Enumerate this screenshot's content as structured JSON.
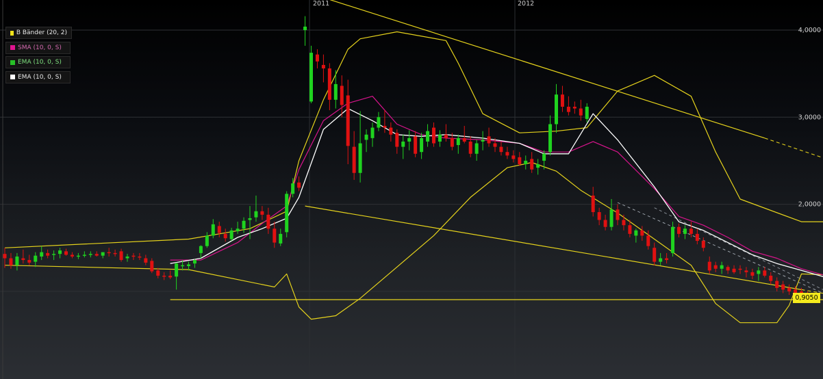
{
  "chart_data": {
    "type": "candlestick",
    "x_ticks": [
      "2011",
      "2012"
    ],
    "y_ticks": [
      "4,0000",
      "3,0000",
      "2,0000"
    ],
    "last_price_label": "0,9050",
    "legend": [
      {
        "label": "B Bänder (20, 2)",
        "color": "#f2e31b"
      },
      {
        "label": "SMA (10, 0, S)",
        "color": "#e0148f"
      },
      {
        "label": "EMA (10, 0, S)",
        "color": "#27c127"
      },
      {
        "label": "EMA (10, 0, S)",
        "color": "#ffffff"
      }
    ],
    "colors": {
      "up": "#1fd31f",
      "down": "#e01111",
      "band": "#e6d31c",
      "sma": "#d8148c",
      "ema": "#ffffff",
      "trend": "#e6d31c"
    },
    "candles": [
      [
        1.43,
        1.5,
        1.27,
        1.38
      ],
      [
        1.38,
        1.44,
        1.26,
        1.3
      ],
      [
        1.3,
        1.44,
        1.24,
        1.4
      ],
      [
        1.38,
        1.48,
        1.32,
        1.36
      ],
      [
        1.36,
        1.42,
        1.3,
        1.33
      ],
      [
        1.34,
        1.45,
        1.28,
        1.41
      ],
      [
        1.4,
        1.52,
        1.36,
        1.45
      ],
      [
        1.44,
        1.48,
        1.38,
        1.41
      ],
      [
        1.42,
        1.47,
        1.36,
        1.43
      ],
      [
        1.43,
        1.5,
        1.38,
        1.47
      ],
      [
        1.46,
        1.49,
        1.41,
        1.42
      ],
      [
        1.42,
        1.45,
        1.38,
        1.4
      ],
      [
        1.4,
        1.44,
        1.37,
        1.41
      ],
      [
        1.41,
        1.46,
        1.39,
        1.42
      ],
      [
        1.42,
        1.46,
        1.39,
        1.43
      ],
      [
        1.43,
        1.46,
        1.4,
        1.41
      ],
      [
        1.41,
        1.45,
        1.38,
        1.45
      ],
      [
        1.45,
        1.5,
        1.4,
        1.44
      ],
      [
        1.44,
        1.48,
        1.4,
        1.43
      ],
      [
        1.46,
        1.49,
        1.34,
        1.36
      ],
      [
        1.38,
        1.43,
        1.34,
        1.4
      ],
      [
        1.41,
        1.44,
        1.36,
        1.4
      ],
      [
        1.4,
        1.44,
        1.36,
        1.39
      ],
      [
        1.38,
        1.42,
        1.3,
        1.33
      ],
      [
        1.35,
        1.38,
        1.21,
        1.23
      ],
      [
        1.24,
        1.27,
        1.15,
        1.18
      ],
      [
        1.18,
        1.22,
        1.13,
        1.17
      ],
      [
        1.18,
        1.24,
        1.14,
        1.16
      ],
      [
        1.17,
        1.33,
        1.02,
        1.32
      ],
      [
        1.3,
        1.36,
        1.24,
        1.3
      ],
      [
        1.29,
        1.34,
        1.24,
        1.31
      ],
      [
        1.32,
        1.37,
        1.27,
        1.36
      ],
      [
        1.44,
        1.53,
        1.38,
        1.52
      ],
      [
        1.52,
        1.68,
        1.5,
        1.64
      ],
      [
        1.64,
        1.83,
        1.61,
        1.77
      ],
      [
        1.75,
        1.8,
        1.62,
        1.67
      ],
      [
        1.66,
        1.72,
        1.57,
        1.61
      ],
      [
        1.6,
        1.73,
        1.58,
        1.7
      ],
      [
        1.69,
        1.8,
        1.66,
        1.72
      ],
      [
        1.72,
        1.85,
        1.67,
        1.81
      ],
      [
        1.82,
        1.98,
        1.6,
        1.84
      ],
      [
        1.85,
        2.1,
        1.8,
        1.92
      ],
      [
        1.92,
        1.98,
        1.82,
        1.88
      ],
      [
        1.88,
        1.96,
        1.66,
        1.72
      ],
      [
        1.72,
        1.8,
        1.5,
        1.56
      ],
      [
        1.55,
        1.72,
        1.52,
        1.66
      ],
      [
        1.68,
        2.15,
        1.62,
        2.12
      ],
      [
        2.12,
        2.3,
        2.08,
        2.24
      ],
      [
        2.25,
        2.32,
        2.15,
        2.19
      ],
      [
        4.0,
        4.16,
        3.82,
        4.04
      ],
      [
        3.18,
        3.82,
        3.16,
        3.74
      ],
      [
        3.72,
        3.78,
        3.56,
        3.64
      ],
      [
        3.6,
        3.72,
        3.4,
        3.56
      ],
      [
        3.56,
        3.62,
        3.08,
        3.2
      ],
      [
        3.2,
        3.54,
        3.1,
        3.38
      ],
      [
        3.36,
        3.48,
        3.0,
        3.14
      ],
      [
        3.25,
        3.43,
        2.46,
        2.67
      ],
      [
        2.66,
        2.84,
        2.28,
        2.36
      ],
      [
        2.36,
        3.07,
        2.25,
        2.7
      ],
      [
        2.74,
        2.86,
        2.6,
        2.8
      ],
      [
        2.76,
        2.94,
        2.66,
        2.88
      ],
      [
        2.88,
        3.06,
        2.84,
        3.0
      ],
      [
        2.9,
        3.08,
        2.82,
        2.88
      ],
      [
        2.88,
        2.94,
        2.72,
        2.8
      ],
      [
        2.82,
        2.86,
        2.58,
        2.66
      ],
      [
        2.66,
        2.8,
        2.52,
        2.72
      ],
      [
        2.72,
        2.85,
        2.62,
        2.76
      ],
      [
        2.78,
        2.84,
        2.54,
        2.58
      ],
      [
        2.6,
        2.82,
        2.52,
        2.76
      ],
      [
        2.72,
        2.92,
        2.66,
        2.84
      ],
      [
        2.88,
        2.94,
        2.66,
        2.7
      ],
      [
        2.72,
        2.85,
        2.66,
        2.8
      ],
      [
        2.8,
        2.92,
        2.72,
        2.76
      ],
      [
        2.76,
        2.82,
        2.62,
        2.66
      ],
      [
        2.68,
        2.8,
        2.58,
        2.76
      ],
      [
        2.76,
        2.9,
        2.7,
        2.72
      ],
      [
        2.72,
        2.78,
        2.54,
        2.58
      ],
      [
        2.58,
        2.74,
        2.5,
        2.7
      ],
      [
        2.72,
        2.84,
        2.62,
        2.74
      ],
      [
        2.78,
        2.88,
        2.66,
        2.7
      ],
      [
        2.7,
        2.76,
        2.6,
        2.66
      ],
      [
        2.66,
        2.72,
        2.56,
        2.6
      ],
      [
        2.6,
        2.66,
        2.52,
        2.56
      ],
      [
        2.56,
        2.62,
        2.48,
        2.52
      ],
      [
        2.54,
        2.6,
        2.44,
        2.46
      ],
      [
        2.46,
        2.56,
        2.4,
        2.5
      ],
      [
        2.52,
        2.6,
        2.36,
        2.4
      ],
      [
        2.42,
        2.52,
        2.34,
        2.46
      ],
      [
        2.5,
        2.62,
        2.4,
        2.58
      ],
      [
        2.6,
        3.02,
        2.56,
        2.92
      ],
      [
        2.92,
        3.38,
        2.82,
        3.26
      ],
      [
        3.26,
        3.36,
        3.06,
        3.12
      ],
      [
        3.12,
        3.24,
        3.02,
        3.06
      ],
      [
        3.12,
        3.18,
        3.04,
        3.1
      ],
      [
        3.1,
        3.2,
        2.96,
        3.02
      ],
      [
        2.98,
        3.16,
        2.94,
        3.12
      ],
      [
        2.1,
        2.2,
        1.86,
        1.91
      ],
      [
        1.91,
        1.96,
        1.76,
        1.82
      ],
      [
        1.82,
        1.88,
        1.7,
        1.74
      ],
      [
        1.74,
        2.06,
        1.7,
        1.94
      ],
      [
        1.94,
        2.0,
        1.76,
        1.82
      ],
      [
        1.82,
        1.88,
        1.7,
        1.76
      ],
      [
        1.76,
        1.82,
        1.62,
        1.66
      ],
      [
        1.64,
        1.72,
        1.56,
        1.7
      ],
      [
        1.7,
        1.75,
        1.58,
        1.64
      ],
      [
        1.64,
        1.7,
        1.48,
        1.52
      ],
      [
        1.5,
        1.56,
        1.3,
        1.34
      ],
      [
        1.34,
        1.44,
        1.3,
        1.38
      ],
      [
        1.38,
        1.44,
        1.32,
        1.36
      ],
      [
        1.44,
        1.8,
        1.4,
        1.74
      ],
      [
        1.74,
        1.78,
        1.62,
        1.66
      ],
      [
        1.66,
        1.76,
        1.6,
        1.72
      ],
      [
        1.72,
        1.8,
        1.62,
        1.66
      ],
      [
        1.66,
        1.72,
        1.54,
        1.58
      ],
      [
        1.58,
        1.62,
        1.46,
        1.5
      ],
      [
        1.34,
        1.4,
        1.2,
        1.24
      ],
      [
        1.3,
        1.34,
        1.22,
        1.26
      ],
      [
        1.26,
        1.34,
        1.2,
        1.3
      ],
      [
        1.28,
        1.3,
        1.2,
        1.24
      ],
      [
        1.26,
        1.3,
        1.2,
        1.22
      ],
      [
        1.26,
        1.3,
        1.2,
        1.25
      ],
      [
        1.24,
        1.28,
        1.16,
        1.22
      ],
      [
        1.22,
        1.26,
        1.14,
        1.18
      ],
      [
        1.2,
        1.28,
        1.12,
        1.24
      ],
      [
        1.24,
        1.28,
        1.16,
        1.18
      ],
      [
        1.18,
        1.22,
        1.08,
        1.12
      ],
      [
        1.12,
        1.16,
        1.0,
        1.04
      ],
      [
        1.08,
        1.12,
        0.98,
        1.02
      ],
      [
        1.04,
        1.08,
        0.96,
        1.0
      ],
      [
        1.02,
        1.06,
        0.94,
        0.98
      ],
      [
        1.0,
        1.04,
        0.92,
        0.96
      ],
      [
        0.98,
        1.0,
        0.9,
        0.91
      ]
    ],
    "bollinger_upper": [
      [
        0,
        1.5
      ],
      [
        30,
        1.6
      ],
      [
        40,
        1.72
      ],
      [
        46,
        1.92
      ],
      [
        48,
        2.5
      ],
      [
        52,
        3.2
      ],
      [
        56,
        3.78
      ],
      [
        58,
        3.9
      ],
      [
        64,
        3.98
      ],
      [
        72,
        3.88
      ],
      [
        74,
        3.62
      ],
      [
        78,
        3.04
      ],
      [
        84,
        2.82
      ],
      [
        90,
        2.84
      ],
      [
        95,
        2.88
      ],
      [
        100,
        3.3
      ],
      [
        106,
        3.48
      ],
      [
        112,
        3.24
      ],
      [
        116,
        2.6
      ],
      [
        120,
        2.06
      ],
      [
        130,
        1.8
      ],
      [
        138,
        1.8
      ]
    ],
    "bollinger_lower": [
      [
        0,
        1.3
      ],
      [
        30,
        1.25
      ],
      [
        44,
        1.05
      ],
      [
        46,
        1.2
      ],
      [
        48,
        0.82
      ],
      [
        50,
        0.68
      ],
      [
        54,
        0.72
      ],
      [
        58,
        0.92
      ],
      [
        64,
        1.28
      ],
      [
        70,
        1.64
      ],
      [
        76,
        2.08
      ],
      [
        82,
        2.42
      ],
      [
        86,
        2.48
      ],
      [
        90,
        2.38
      ],
      [
        94,
        2.16
      ],
      [
        100,
        1.9
      ],
      [
        106,
        1.6
      ],
      [
        112,
        1.3
      ],
      [
        116,
        0.86
      ],
      [
        120,
        0.64
      ],
      [
        126,
        0.64
      ],
      [
        128,
        0.84
      ],
      [
        130,
        1.2
      ],
      [
        138,
        1.18
      ]
    ],
    "sma": [
      [
        27,
        1.36
      ],
      [
        32,
        1.36
      ],
      [
        38,
        1.56
      ],
      [
        42,
        1.78
      ],
      [
        46,
        1.98
      ],
      [
        48,
        2.4
      ],
      [
        52,
        2.96
      ],
      [
        56,
        3.16
      ],
      [
        60,
        3.24
      ],
      [
        64,
        2.92
      ],
      [
        68,
        2.8
      ],
      [
        72,
        2.76
      ],
      [
        78,
        2.74
      ],
      [
        84,
        2.7
      ],
      [
        88,
        2.6
      ],
      [
        92,
        2.6
      ],
      [
        96,
        2.72
      ],
      [
        100,
        2.6
      ],
      [
        106,
        2.18
      ],
      [
        110,
        1.86
      ],
      [
        114,
        1.76
      ],
      [
        118,
        1.62
      ],
      [
        122,
        1.46
      ],
      [
        126,
        1.38
      ],
      [
        130,
        1.26
      ],
      [
        136,
        1.14
      ]
    ],
    "ema": [
      [
        27,
        1.32
      ],
      [
        32,
        1.38
      ],
      [
        38,
        1.62
      ],
      [
        42,
        1.72
      ],
      [
        46,
        1.84
      ],
      [
        48,
        2.08
      ],
      [
        52,
        2.86
      ],
      [
        56,
        3.1
      ],
      [
        60,
        2.96
      ],
      [
        64,
        2.8
      ],
      [
        68,
        2.78
      ],
      [
        72,
        2.8
      ],
      [
        78,
        2.76
      ],
      [
        84,
        2.7
      ],
      [
        88,
        2.58
      ],
      [
        92,
        2.58
      ],
      [
        96,
        3.04
      ],
      [
        100,
        2.74
      ],
      [
        106,
        2.2
      ],
      [
        110,
        1.8
      ],
      [
        114,
        1.7
      ],
      [
        118,
        1.56
      ],
      [
        122,
        1.42
      ],
      [
        126,
        1.32
      ],
      [
        130,
        1.24
      ],
      [
        136,
        1.12
      ]
    ],
    "bollinger_upper_far": [
      [
        0,
        1.5
      ],
      [
        138,
        1.5
      ]
    ],
    "trend_lines": [
      {
        "from": [
          49,
          4.44
        ],
        "to": [
          124,
          2.76
        ],
        "dashed_to": [
          140,
          2.38
        ]
      },
      {
        "from": [
          49,
          1.98
        ],
        "to": [
          130,
          1.02
        ],
        "dashed_to": [
          140,
          0.9
        ]
      },
      {
        "from": [
          27,
          0.905
        ],
        "to": [
          138,
          0.905
        ]
      }
    ]
  }
}
